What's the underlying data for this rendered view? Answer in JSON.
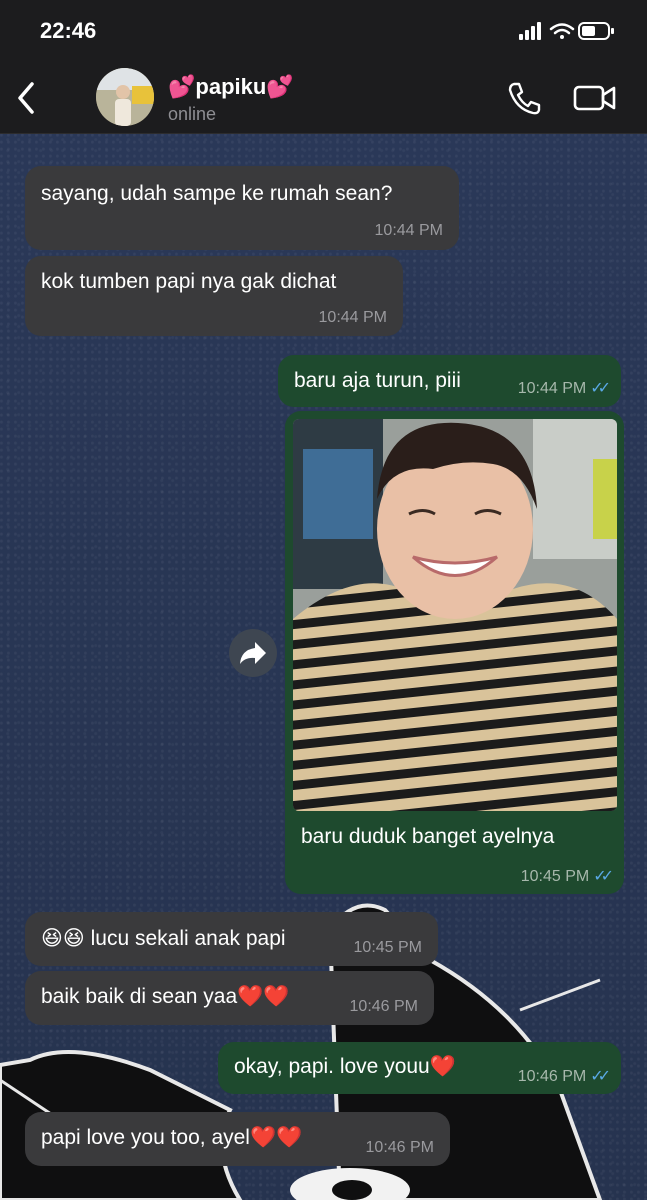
{
  "status_bar": {
    "time": "22:46"
  },
  "header": {
    "contact_name": "💕papiku💕",
    "contact_status": "online"
  },
  "messages": [
    {
      "dir": "in",
      "text": "sayang, udah sampe ke rumah sean?",
      "time": "10:44 PM"
    },
    {
      "dir": "in",
      "text": "kok tumben papi nya gak dichat",
      "time": "10:44 PM"
    },
    {
      "dir": "out",
      "text": "baru aja turun, piii",
      "time": "10:44 PM"
    },
    {
      "dir": "out",
      "type": "photo",
      "caption": "baru duduk banget ayelnya",
      "time": "10:45 PM"
    },
    {
      "dir": "in",
      "text": "😆😆 lucu sekali anak papi",
      "time": "10:45 PM"
    },
    {
      "dir": "in",
      "text": "baik baik di sean yaa❤️❤️",
      "time": "10:46 PM"
    },
    {
      "dir": "out",
      "text": "okay, papi. love youu❤️",
      "time": "10:46 PM"
    },
    {
      "dir": "in",
      "text": "papi love you too, ayel❤️❤️",
      "time": "10:46 PM"
    }
  ],
  "colors": {
    "incoming_bubble": "#3a3a3c",
    "outgoing_bubble": "#1e4a2e",
    "read_tick": "#5aa9e6",
    "wallpaper": "#273553"
  },
  "icons": [
    "back-chevron-icon",
    "call-icon",
    "video-call-icon",
    "forward-icon",
    "signal-icon",
    "wifi-icon",
    "battery-icon",
    "read-ticks-icon"
  ]
}
